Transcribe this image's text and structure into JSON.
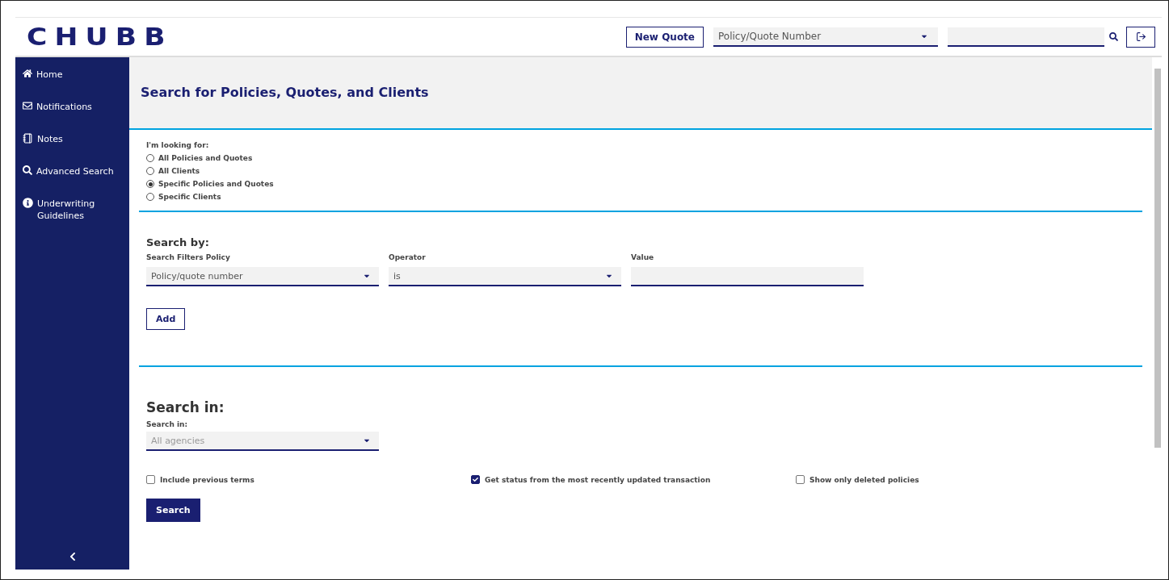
{
  "header": {
    "logo": "CHUBB",
    "new_quote": "New Quote",
    "search_type": "Policy/Quote Number"
  },
  "sidebar": {
    "items": [
      {
        "label": "Home"
      },
      {
        "label": "Notifications"
      },
      {
        "label": "Notes"
      },
      {
        "label": "Advanced Search"
      },
      {
        "label": "Underwriting Guidelines"
      }
    ]
  },
  "page": {
    "title": "Search for Policies, Quotes, and Clients",
    "looking_for": {
      "label": "I'm looking for:",
      "options": [
        {
          "label": "All Policies and Quotes",
          "selected": false
        },
        {
          "label": "All Clients",
          "selected": false
        },
        {
          "label": "Specific Policies and Quotes",
          "selected": true
        },
        {
          "label": "Specific Clients",
          "selected": false
        }
      ]
    },
    "search_by": {
      "heading": "Search by:",
      "fields": [
        {
          "label": "Search Filters Policy",
          "value": "Policy/quote number",
          "kind": "select"
        },
        {
          "label": "Operator",
          "value": "is",
          "kind": "select"
        },
        {
          "label": "Value",
          "kind": "text"
        }
      ],
      "add_button": "Add"
    },
    "search_in": {
      "heading": "Search in:",
      "label": "Search in:",
      "value": "All agencies",
      "options": [
        {
          "label": "Include previous terms",
          "checked": false
        },
        {
          "label": "Get status from the most recently updated transaction",
          "checked": true
        },
        {
          "label": "Show only deleted policies",
          "checked": false
        }
      ],
      "search_button": "Search"
    }
  }
}
